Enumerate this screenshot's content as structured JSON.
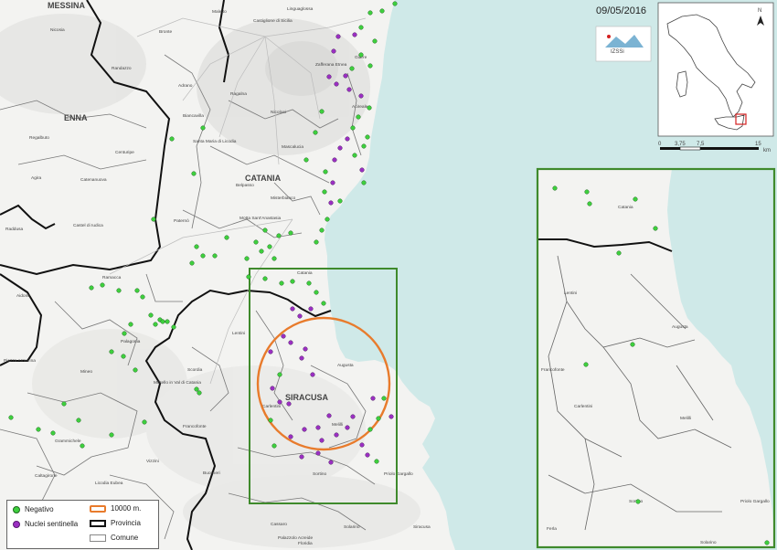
{
  "date": "09/05/2016",
  "colors": {
    "sea": "#cfe9e8",
    "land": "#f3f3f1",
    "negativo": "#3ecf3e",
    "nuclei": "#9b2fc2",
    "buffer": "#e87b2c",
    "study_box": "#3f8a2c",
    "provincia": "#111111"
  },
  "provinces": [
    "MESSINA",
    "ENNA",
    "CATANIA",
    "SIRACUSA"
  ],
  "places_main": [
    {
      "label": "Linguaglossa"
    },
    {
      "label": "Castiglione di Sicilia"
    },
    {
      "label": "Maletto"
    },
    {
      "label": "Bronte"
    },
    {
      "label": "Randazzo"
    },
    {
      "label": "Giarre"
    },
    {
      "label": "Adrano"
    },
    {
      "label": "Biancavilla"
    },
    {
      "label": "Paternò"
    },
    {
      "label": "Catania"
    },
    {
      "label": "Acireale"
    },
    {
      "label": "Augusta"
    },
    {
      "label": "Lentini"
    },
    {
      "label": "Carlentini"
    },
    {
      "label": "Melilli"
    },
    {
      "label": "Sortino"
    },
    {
      "label": "Priolo Gargallo"
    },
    {
      "label": "Palagonia"
    },
    {
      "label": "Ramacca"
    },
    {
      "label": "Mineo"
    },
    {
      "label": "Scordia"
    },
    {
      "label": "Francofonte"
    },
    {
      "label": "Vizzini"
    },
    {
      "label": "Buccheri"
    },
    {
      "label": "Grammichele"
    },
    {
      "label": "Caltagirone"
    },
    {
      "label": "Cassaro"
    },
    {
      "label": "Siracusa"
    },
    {
      "label": "Agira"
    },
    {
      "label": "Regalbuto"
    },
    {
      "label": "Centuripe"
    },
    {
      "label": "Catenanuova"
    },
    {
      "label": "Nicosia"
    },
    {
      "label": "Raddusa"
    },
    {
      "label": "Aidone"
    },
    {
      "label": "Mascalucia"
    },
    {
      "label": "Nicolosi"
    },
    {
      "label": "Zafferana Etnea"
    },
    {
      "label": "Misterbianco"
    },
    {
      "label": "Motta Sant'Anastasia"
    },
    {
      "label": "Belpasso"
    },
    {
      "label": "Ragalna"
    },
    {
      "label": "Santa Maria di Licodia"
    },
    {
      "label": "Palazzolo Acreide"
    },
    {
      "label": "Militello in Val di Catania"
    },
    {
      "label": "Piazza Armerina"
    },
    {
      "label": "Licodia Eubea"
    },
    {
      "label": "Castel di Iudica"
    },
    {
      "label": "Solarino"
    },
    {
      "label": "Floridia"
    }
  ],
  "places_inset": [
    {
      "label": "Catania"
    },
    {
      "label": "Lentini"
    },
    {
      "label": "Augusta"
    },
    {
      "label": "Carlentini"
    },
    {
      "label": "Francofonte"
    },
    {
      "label": "Melilli"
    },
    {
      "label": "Sortino"
    },
    {
      "label": "Priolo Gargallo"
    },
    {
      "label": "Ferla"
    },
    {
      "label": "Solarino"
    }
  ],
  "scalebar": {
    "ticks": [
      "0",
      "3,75",
      "7,5",
      "15"
    ],
    "unit": "km"
  },
  "north": "N",
  "logo_text": "IZSSi",
  "legend": {
    "negativo": "Negativo",
    "nuclei": "Nuclei sentinella",
    "buffer": "10000 m.",
    "provincia": "Provincia",
    "comune": "Comune"
  }
}
